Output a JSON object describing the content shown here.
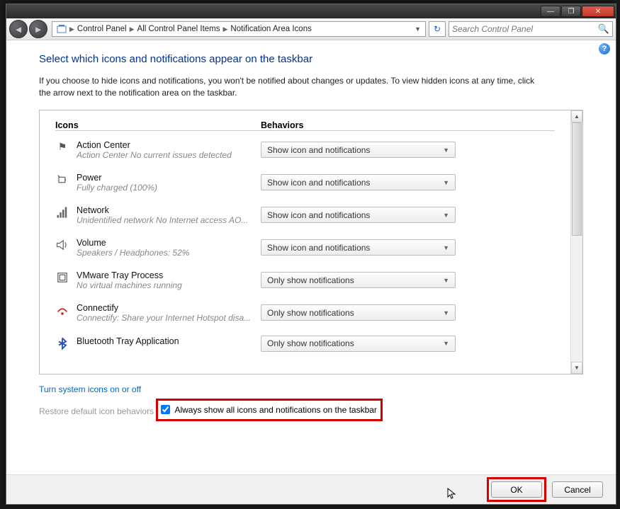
{
  "breadcrumb": {
    "items": [
      "Control Panel",
      "All Control Panel Items",
      "Notification Area Icons"
    ]
  },
  "search": {
    "placeholder": "Search Control Panel"
  },
  "page": {
    "title": "Select which icons and notifications appear on the taskbar",
    "description": "If you choose to hide icons and notifications, you won't be notified about changes or updates. To view hidden icons at any time, click the arrow next to the notification area on the taskbar."
  },
  "columns": {
    "icons": "Icons",
    "behaviors": "Behaviors"
  },
  "rows": [
    {
      "name": "Action Center",
      "sub": "Action Center  No current issues detected",
      "behavior": "Show icon and notifications",
      "icon": "flag-icon"
    },
    {
      "name": "Power",
      "sub": "Fully charged (100%)",
      "behavior": "Show icon and notifications",
      "icon": "power-icon"
    },
    {
      "name": "Network",
      "sub": "Unidentified network No Internet access AO...",
      "behavior": "Show icon and notifications",
      "icon": "network-icon"
    },
    {
      "name": "Volume",
      "sub": "Speakers / Headphones: 52%",
      "behavior": "Show icon and notifications",
      "icon": "volume-icon"
    },
    {
      "name": "VMware Tray Process",
      "sub": "No virtual machines running",
      "behavior": "Only show notifications",
      "icon": "vmware-icon"
    },
    {
      "name": "Connectify",
      "sub": "Connectify: Share your Internet Hotspot disa...",
      "behavior": "Only show notifications",
      "icon": "connectify-icon"
    },
    {
      "name": "Bluetooth Tray Application",
      "sub": "",
      "behavior": "Only show notifications",
      "icon": "bluetooth-icon"
    }
  ],
  "links": {
    "system_icons": "Turn system icons on or off",
    "restore": "Restore default icon behaviors"
  },
  "checkbox": {
    "label": "Always show all icons and notifications on the taskbar",
    "checked": true
  },
  "buttons": {
    "ok": "OK",
    "cancel": "Cancel"
  }
}
